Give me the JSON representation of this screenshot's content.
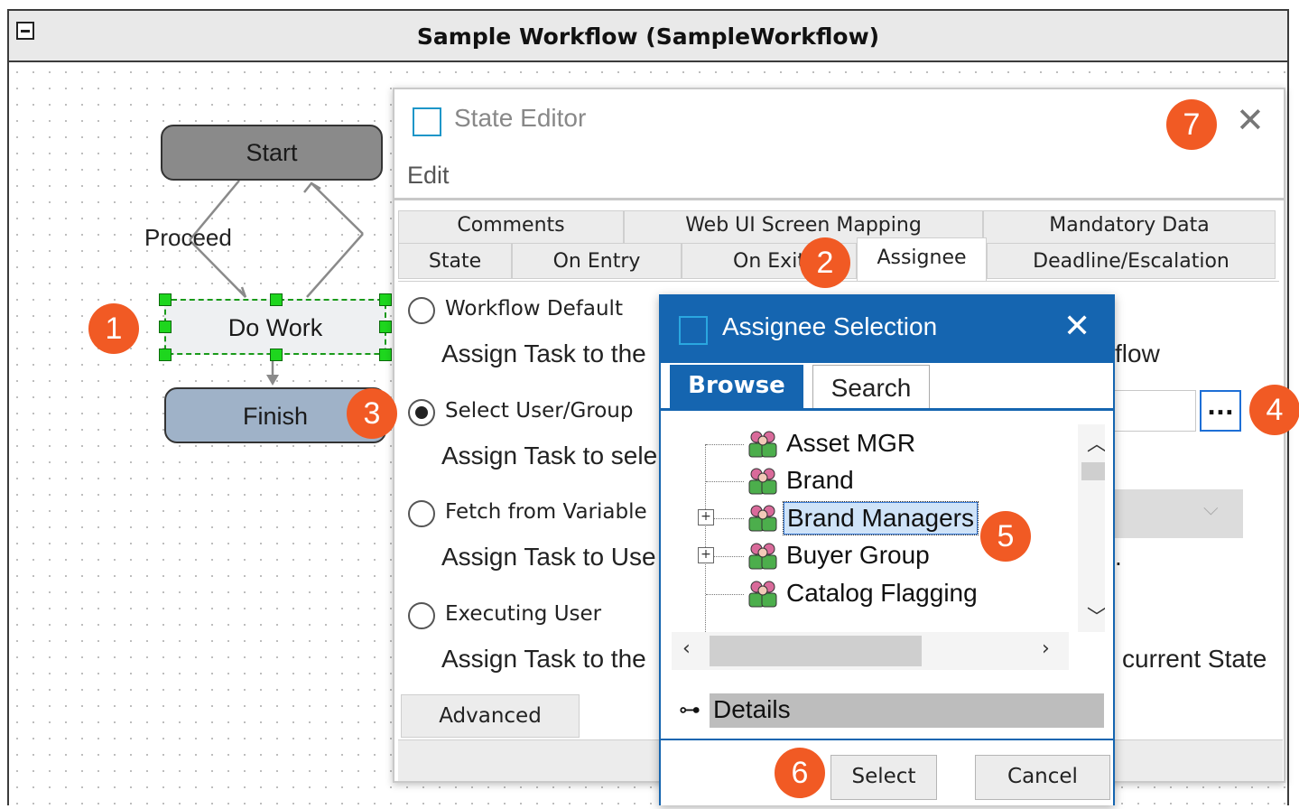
{
  "workflow": {
    "title": "Sample Workflow (SampleWorkflow)",
    "nodes": {
      "start": "Start",
      "do_work": "Do Work",
      "finish": "Finish"
    },
    "transition_label": "Proceed"
  },
  "state_editor": {
    "title": "State Editor",
    "menu": {
      "edit": "Edit"
    },
    "tabs_row1": [
      "Comments",
      "Web UI Screen Mapping",
      "Mandatory Data"
    ],
    "tabs_row2": [
      "State",
      "On Entry",
      "On Exit",
      "Assignee",
      "Deadline/Escalation"
    ],
    "active_tab": "Assignee",
    "options": [
      {
        "label": "Workflow Default",
        "desc": "Assign Task to the",
        "checked": false
      },
      {
        "label": "Select User/Group",
        "desc": "Assign Task to sele",
        "checked": true
      },
      {
        "label": "Fetch from Variable",
        "desc": "Assign Task to Use",
        "checked": false
      },
      {
        "label": "Executing User",
        "desc": "Assign Task to the",
        "checked": false
      }
    ],
    "partial_texts": {
      "workflow_tail": "flow",
      "variable_tail": ".",
      "state_tail": "current State"
    },
    "browse_button": "...",
    "advanced_button": "Advanced"
  },
  "assignee_selection": {
    "title": "Assignee Selection",
    "tabs": {
      "browse": "Browse",
      "search": "Search"
    },
    "active_tab": "Browse",
    "tree_items": [
      {
        "label": "Asset MGR",
        "expandable": false,
        "selected": false
      },
      {
        "label": "Brand",
        "expandable": false,
        "selected": false
      },
      {
        "label": "Brand Managers",
        "expandable": true,
        "selected": true
      },
      {
        "label": "Buyer Group",
        "expandable": true,
        "selected": false
      },
      {
        "label": "Catalog Flagging",
        "expandable": false,
        "selected": false
      }
    ],
    "details_label": "Details",
    "select_button": "Select",
    "cancel_button": "Cancel"
  },
  "callouts": [
    "1",
    "2",
    "3",
    "4",
    "5",
    "6",
    "7"
  ],
  "colors": {
    "accent": "#1565b0",
    "callout": "#f15a24",
    "node_start": "#8a8a8a",
    "node_finish": "#9fb2c8",
    "selection": "#1ed61e"
  }
}
